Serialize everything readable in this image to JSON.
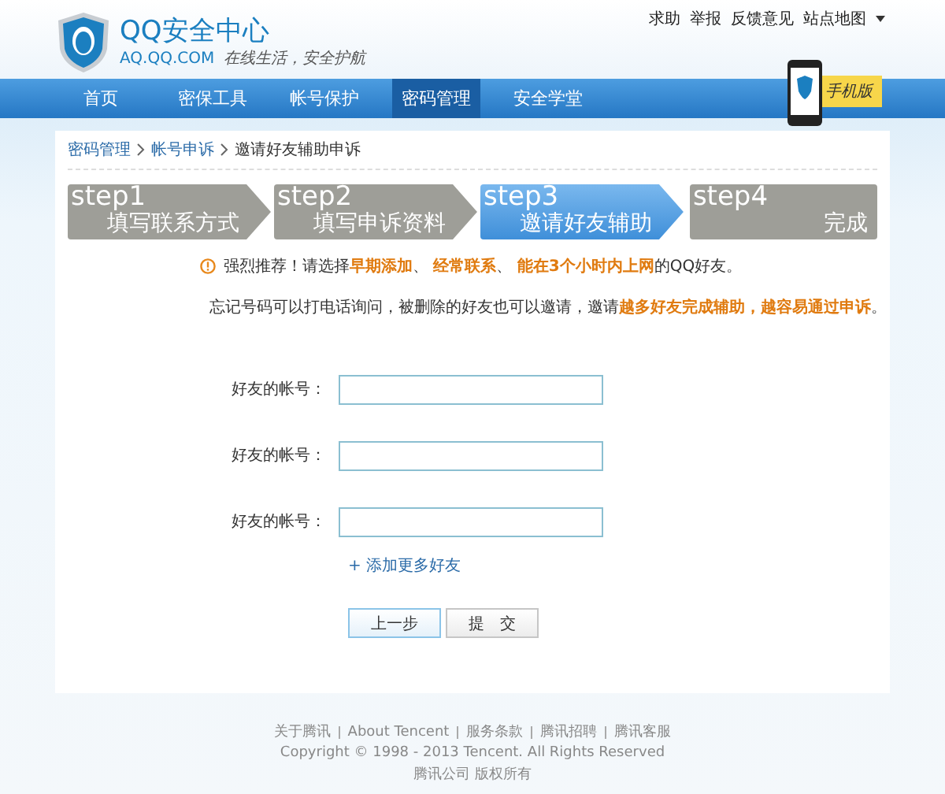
{
  "header": {
    "title": "QQ安全中心",
    "domain": "AQ.QQ.COM",
    "slogan": "在线生活，安全护航",
    "links": [
      "求助",
      "举报",
      "反馈意见",
      "站点地图"
    ],
    "mobile_badge": "手机版"
  },
  "nav": [
    {
      "label": "首页",
      "selected": false
    },
    {
      "label": "密保工具",
      "selected": false
    },
    {
      "label": "帐号保护",
      "selected": false
    },
    {
      "label": "密码管理",
      "selected": true
    },
    {
      "label": "安全学堂",
      "selected": false
    }
  ],
  "breadcrumb": [
    "密码管理",
    "帐号申诉",
    "邀请好友辅助申诉"
  ],
  "steps": [
    {
      "step": "step1",
      "label": "填写联系方式",
      "selected": false
    },
    {
      "step": "step2",
      "label": "填写申诉资料",
      "selected": false
    },
    {
      "step": "step3",
      "label": "邀请好友辅助",
      "selected": true
    },
    {
      "step": "step4",
      "label": "完成",
      "selected": false
    }
  ],
  "notice": "强烈推荐！请选择**早期添加**、 **经常联系**、 **能在3个小时内上网**的QQ好友。",
  "hint": "忘记号码可以打电话询问，被删除的好友也可以邀请，邀请**越多好友完成辅助，越容易通过申诉**。",
  "fields": [
    {
      "label": "好友的帐号："
    },
    {
      "label": "好友的帐号："
    },
    {
      "label": "好友的帐号："
    }
  ],
  "add_more": "+ 添加更多好友",
  "buttons": [
    {
      "label": "上一步",
      "kind": "primary"
    },
    {
      "label": "提　交",
      "kind": "normal"
    }
  ],
  "footer": {
    "links": [
      "关于腾讯",
      "About Tencent",
      "服务条款",
      "腾讯招聘",
      "腾讯客服"
    ],
    "copyright": "Copyright © 1998 - 2013 Tencent. All Rights Reserved",
    "company": "腾讯公司 版权所有"
  }
}
